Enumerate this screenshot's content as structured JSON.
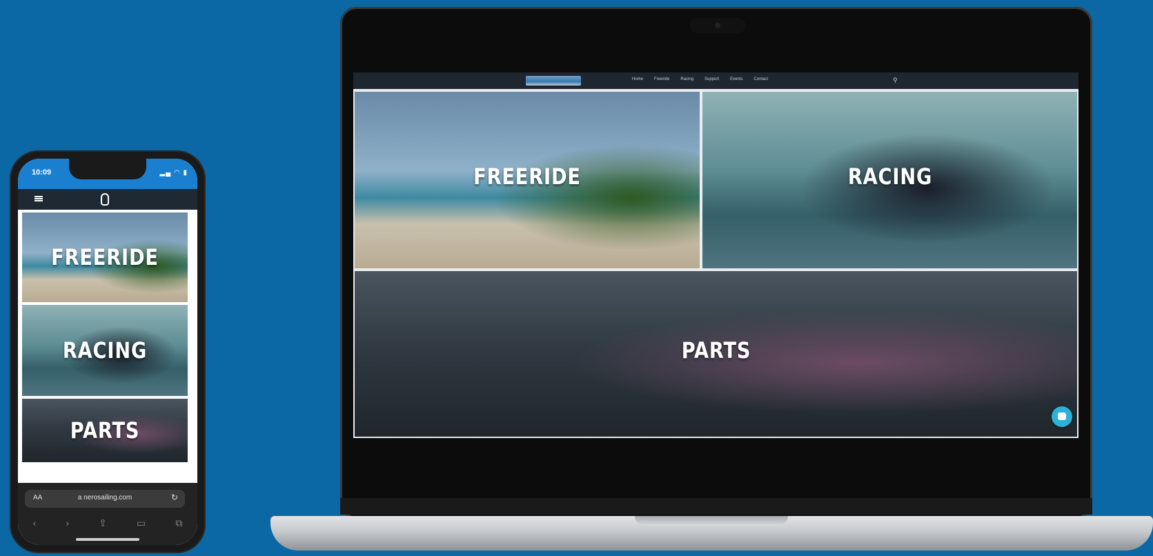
{
  "phone": {
    "status_time": "10:09",
    "sys_icons": "▂▄ ◠ ▮",
    "tiles": [
      {
        "label": "FREERIDE"
      },
      {
        "label": "RACING"
      },
      {
        "label": "PARTS"
      }
    ],
    "url": "a nerosailing.com",
    "aa_label": "AA",
    "reload_icon": "reload-icon"
  },
  "laptop": {
    "nav_links": [
      "Home",
      "Freeride",
      "Racing",
      "Support",
      "Events",
      "Contact"
    ],
    "search_icon": "search-icon",
    "tiles": [
      {
        "label": "FREERIDE"
      },
      {
        "label": "RACING"
      },
      {
        "label": "PARTS"
      }
    ],
    "chat_icon": "chat-bubble-icon"
  },
  "colors": {
    "background": "#0b68a4",
    "phone_status_bar": "#1b7fd0",
    "site_nav": "#1e2630",
    "chat_accent": "#2ab3d6"
  }
}
